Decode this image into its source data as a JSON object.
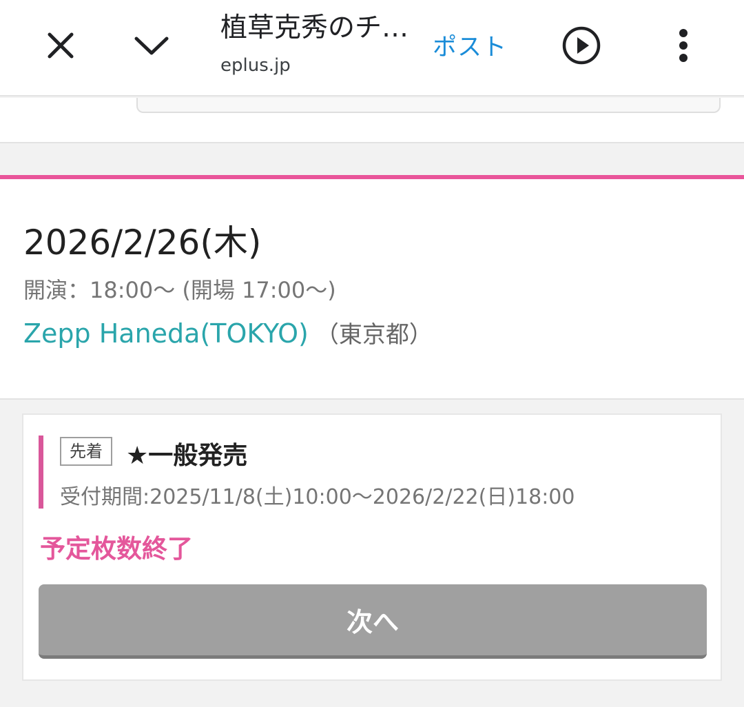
{
  "toolbar": {
    "title": "植草克秀のチ…",
    "url": "eplus.jp",
    "post_label": "ポスト",
    "icons": {
      "close": "close-icon",
      "chevron": "chevron-down-icon",
      "play": "play-circle-icon",
      "more": "more-vert-icon"
    }
  },
  "event": {
    "date": "2026/2/26(木)",
    "time": "開演：18:00〜 (開場 17:00〜)",
    "venue": "Zepp Haneda(TOKYO)",
    "prefecture": "（東京都）"
  },
  "ticket": {
    "badge": "先着",
    "name": "★一般発売",
    "period": "受付期間:2025/11/8(土)10:00〜2026/2/22(日)18:00",
    "status": "予定枚数終了",
    "next_label": "次へ"
  },
  "colors": {
    "accent_pink": "#e9559a",
    "link_teal": "#2aa5ab",
    "post_blue": "#1a8cd8",
    "disabled_button": "#a0a0a0"
  }
}
